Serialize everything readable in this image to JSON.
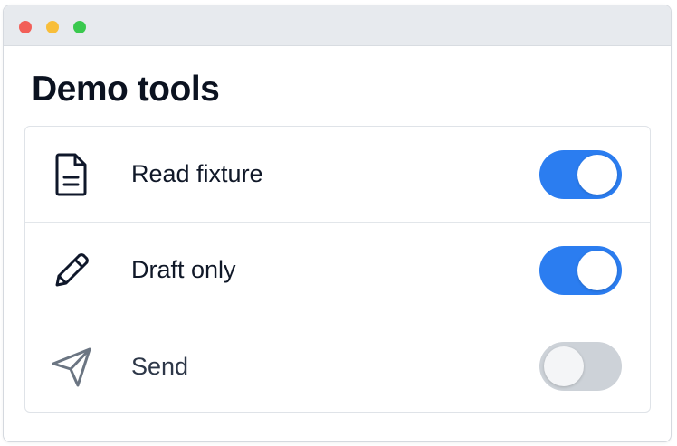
{
  "window": {
    "controls": [
      "close",
      "minimize",
      "maximize"
    ]
  },
  "page": {
    "title": "Demo tools"
  },
  "tools": [
    {
      "label": "Read fixture",
      "icon": "document-icon",
      "enabled": true
    },
    {
      "label": "Draft only",
      "icon": "pencil-icon",
      "enabled": true
    },
    {
      "label": "Send",
      "icon": "paper-plane-icon",
      "enabled": false
    }
  ],
  "colors": {
    "toggle_on": "#2b7df0",
    "toggle_off": "#cdd2d8",
    "text": "#101828"
  }
}
